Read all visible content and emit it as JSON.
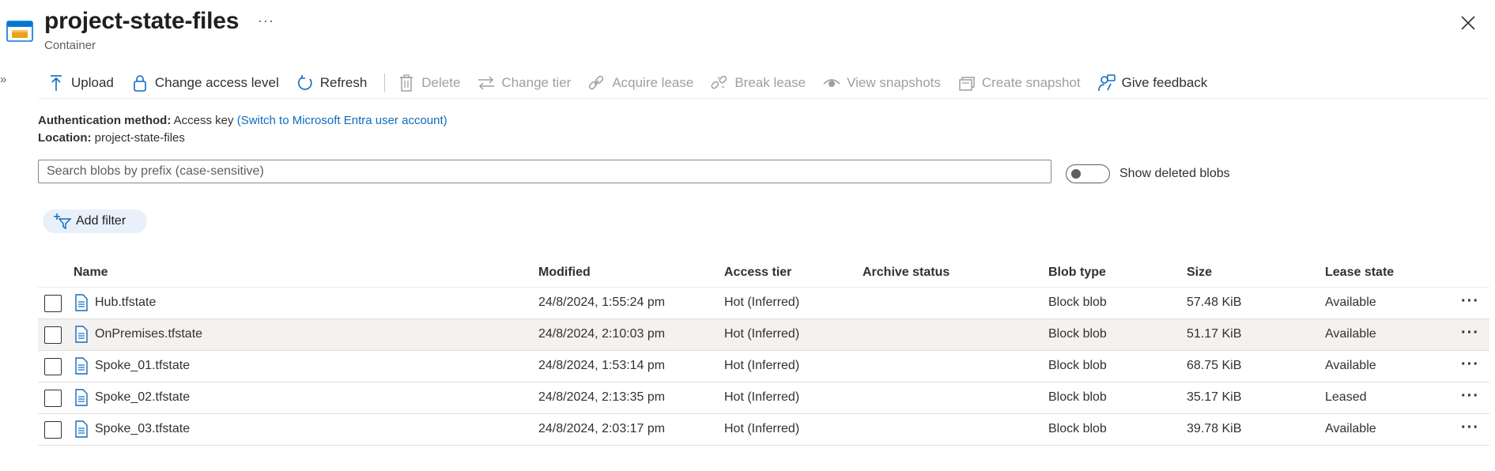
{
  "header": {
    "title": "project-state-files",
    "subtitle": "Container",
    "more": "···",
    "icon": "container-icon",
    "close_icon": "close-icon",
    "expand": "»"
  },
  "toolbar": [
    {
      "label": "Upload",
      "icon": "upload-icon",
      "enabled": true
    },
    {
      "label": "Change access level",
      "icon": "lock-icon",
      "enabled": true
    },
    {
      "label": "Refresh",
      "icon": "refresh-icon",
      "enabled": true
    },
    {
      "label": "Delete",
      "icon": "trash-icon",
      "enabled": false
    },
    {
      "label": "Change tier",
      "icon": "swap-icon",
      "enabled": false
    },
    {
      "label": "Acquire lease",
      "icon": "link-icon",
      "enabled": false
    },
    {
      "label": "Break lease",
      "icon": "broken-link-icon",
      "enabled": false
    },
    {
      "label": "View snapshots",
      "icon": "eye-icon",
      "enabled": false
    },
    {
      "label": "Create snapshot",
      "icon": "snapshot-icon",
      "enabled": false
    },
    {
      "label": "Give feedback",
      "icon": "feedback-icon",
      "enabled": true
    }
  ],
  "info": {
    "auth_key": "Authentication method:",
    "auth_value": "Access key",
    "auth_link": "(Switch to Microsoft Entra user account)",
    "location_key": "Location:",
    "location_value": "project-state-files"
  },
  "search": {
    "placeholder": "Search blobs by prefix (case-sensitive)",
    "value": ""
  },
  "toggle": {
    "label": "Show deleted blobs",
    "on": false
  },
  "filter": {
    "label": "Add filter",
    "icon": "add-filter-icon"
  },
  "table": {
    "columns": [
      "Name",
      "Modified",
      "Access tier",
      "Archive status",
      "Blob type",
      "Size",
      "Lease state"
    ],
    "rows": [
      {
        "name": "Hub.tfstate",
        "modified": "24/8/2024, 1:55:24 pm",
        "tier": "Hot (Inferred)",
        "archive": "",
        "type": "Block blob",
        "size": "57.48 KiB",
        "lease": "Available"
      },
      {
        "name": "OnPremises.tfstate",
        "modified": "24/8/2024, 2:10:03 pm",
        "tier": "Hot (Inferred)",
        "archive": "",
        "type": "Block blob",
        "size": "51.17 KiB",
        "lease": "Available"
      },
      {
        "name": "Spoke_01.tfstate",
        "modified": "24/8/2024, 1:53:14 pm",
        "tier": "Hot (Inferred)",
        "archive": "",
        "type": "Block blob",
        "size": "68.75 KiB",
        "lease": "Available"
      },
      {
        "name": "Spoke_02.tfstate",
        "modified": "24/8/2024, 2:13:35 pm",
        "tier": "Hot (Inferred)",
        "archive": "",
        "type": "Block blob",
        "size": "35.17 KiB",
        "lease": "Leased"
      },
      {
        "name": "Spoke_03.tfstate",
        "modified": "24/8/2024, 2:03:17 pm",
        "tier": "Hot (Inferred)",
        "archive": "",
        "type": "Block blob",
        "size": "39.78 KiB",
        "lease": "Available"
      }
    ],
    "row_more": "···",
    "file_icon": "file-icon"
  },
  "colors": {
    "accent": "#0f6cbd",
    "disabled": "#a19f9d",
    "text": "#323130",
    "row_highlight": "#f3f2f1"
  }
}
